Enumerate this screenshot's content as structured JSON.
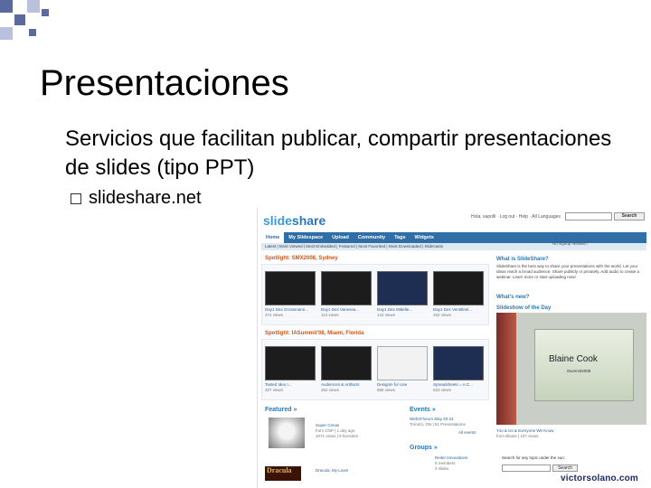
{
  "slide": {
    "title": "Presentaciones",
    "body": "Servicios que facilitan publicar, compartir presentaciones de slides (tipo PPT)",
    "sub_bullet": "slideshare.net",
    "watermark": "victorsolano.com"
  },
  "slideshare": {
    "logo_prefix": "slide",
    "logo_suffix": "share",
    "top_links": "Hola, sapolli · Log out · Help · All Languages",
    "search_button": "Search",
    "nav": [
      "Home",
      "My Slidespace",
      "Upload",
      "Community",
      "Tags",
      "Widgets"
    ],
    "subnav": "Latest | Most Viewed | Most Embedded | Featured | Most Favorited | Most Downloaded | Slidecasts",
    "spotlight1": {
      "title": "Spotlight: SMX2008, Sydney",
      "items": [
        {
          "caption": "Day1 Dex Grossmann...",
          "views": "374 views"
        },
        {
          "caption": "Day1 Dex Vanessa...",
          "views": "113 views"
        },
        {
          "caption": "Day1 Dex Mittelle...",
          "views": "142 views"
        },
        {
          "caption": "Day1 Dex Ventitleel...",
          "views": "152 views"
        }
      ]
    },
    "spotlight2": {
      "title": "Spotlight: IASummit'08, Miami, Florida",
      "items": [
        {
          "caption": "Tasted Ideo I...",
          "views": "327 views"
        },
        {
          "caption": "Audiences & Artifacts",
          "views": "254 views"
        },
        {
          "caption": "Designin for Use",
          "views": "865 views"
        },
        {
          "caption": "Spreadsheets = A.C...",
          "views": "523 views"
        }
      ]
    },
    "featured": {
      "title": "Featured »",
      "item1_title": "Super Cenas",
      "item1_line2": "from ChiP | 1 day ago",
      "item1_line3": "1071 views | 9 favorites",
      "item2_title": "Dracula, My Lover",
      "item2_badge": "Dracula"
    },
    "events": {
      "title": "Events »",
      "line1": "WebVFlorum May 20-21",
      "line2": "Toronto, ON | 51 Presentations",
      "link": "All events"
    },
    "groups": {
      "title": "Groups »",
      "line1": "Reiter Innovations",
      "line2": "8 members",
      "line3": "4 slides"
    },
    "what": {
      "signup_text": "No signup needed?",
      "title": "What is SlideShare?",
      "text": "SlideShare is the best way to share your presentations with the world. Let your ideas reach a broad audience. Share publicly or privately. Add audio to create a webinar. Learn more or start uploading now!",
      "new_title": "What's new?",
      "sotd_title": "Slideshow of the Day"
    },
    "sotd": {
      "name": "Blaine Cook",
      "sub": "iSummit2008",
      "caption1": "You & Us & Everyone We Know",
      "caption2": "from Blaine | 107 views"
    },
    "bottom": {
      "label": "Search for any topic under the sun:",
      "button": "Search"
    }
  }
}
